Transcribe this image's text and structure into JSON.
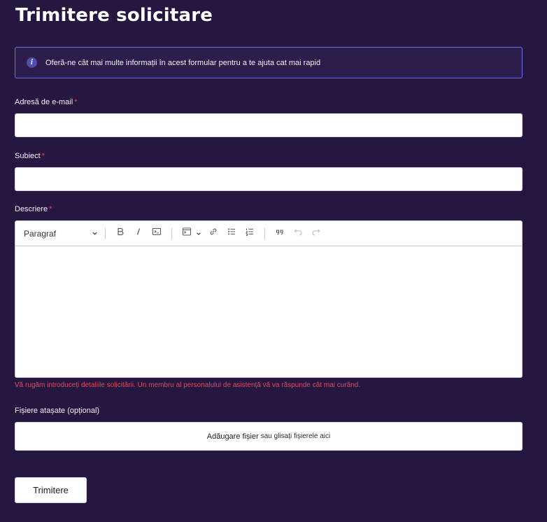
{
  "page": {
    "title": "Trimitere solicitare"
  },
  "info": {
    "text": "Oferă-ne cât mai multe informații în acest formular pentru a te ajuta cat mai rapid",
    "icon": "info-icon"
  },
  "form": {
    "email": {
      "label": "Adresă de e-mail",
      "required_mark": "*",
      "value": ""
    },
    "subject": {
      "label": "Subiect",
      "required_mark": "*",
      "value": ""
    },
    "description": {
      "label": "Descriere",
      "required_mark": "*",
      "heading_select": "Paragraf",
      "toolbar_icons": [
        "chevron-down-icon",
        "bold-icon",
        "italic-icon",
        "code-icon",
        "code-block-icon",
        "link-icon",
        "bulleted-list-icon",
        "numbered-list-icon",
        "blockquote-icon",
        "undo-icon",
        "redo-icon"
      ],
      "hint": "Vă rugăm introduceți detaliile solicitării. Un membru al personalului de asistență vă va răspunde cât mai curând."
    },
    "attachments": {
      "label": "Fișiere atașate (opțional)",
      "add_label": "Adăugare fișier",
      "drop_text": "sau glisați fișierele aici"
    },
    "submit_label": "Trimitere"
  },
  "colors": {
    "background": "#261741",
    "info_border": "#6b6ee8",
    "required": "#e0495b",
    "field": "#ffffff"
  }
}
